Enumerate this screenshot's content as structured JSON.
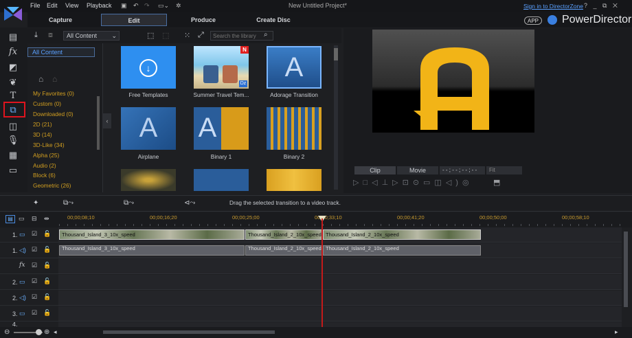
{
  "menu": [
    "File",
    "Edit",
    "View",
    "Playback"
  ],
  "project_title": "New Untitled Project*",
  "signin": "Sign in to DirectorZone",
  "window_controls": "? _ ⧉ ✕",
  "brand": {
    "app_badge": "APP",
    "name": "PowerDirector",
    "accent": "#3a7fe0"
  },
  "modes": {
    "capture": "Capture",
    "edit": "Edit",
    "produce": "Produce",
    "create_disc": "Create Disc"
  },
  "library": {
    "filter": "All Content",
    "search_placeholder": "Search the library"
  },
  "categories": {
    "all": "All Content",
    "items": [
      "My Favorites  (0)",
      "Custom  (0)",
      "Downloaded  (0)",
      "2D  (21)",
      "3D  (14)",
      "3D-Like  (34)",
      "Alpha  (25)",
      "Audio  (2)",
      "Block  (6)",
      "Geometric  (26)"
    ]
  },
  "thumbnails": [
    {
      "label": "Free Templates",
      "badge": ""
    },
    {
      "label": "Summer Travel Tem...",
      "badge": "N"
    },
    {
      "label": "Adorage Transition",
      "badge": ""
    },
    {
      "label": "Airplane",
      "badge": ""
    },
    {
      "label": "Binary 1",
      "badge": ""
    },
    {
      "label": "Binary 2",
      "badge": ""
    }
  ],
  "thumb_glyph": "A",
  "preview": {
    "clip_tab": "Clip",
    "movie_tab": "Movie",
    "timecode": "- - ; - - ; - - ; - -",
    "fit": "Fit",
    "letter": "A"
  },
  "fx_hint": "Drag the selected transition to a video track.",
  "ruler": [
    "00;00;08;10",
    "00;00;16;20",
    "00;00;25;00",
    "00;00;33;10",
    "00;00;41;20",
    "00;00;50;00",
    "00;00;58;10"
  ],
  "tracks": {
    "t1_video_label": "1.",
    "t1_audio_label": "1.",
    "fx_label": "fx",
    "t2_video_label": "2.",
    "t2_audio_label": "2.",
    "t3_video_label": "3.",
    "t4_label": "4."
  },
  "clips": {
    "v1": "Thousand_Island_3_10x_speed",
    "v2": "Thousand_Island_2_10x_speed",
    "v3": "Thousand_Island_2_10x_speed",
    "a1": "Thousand_Island_3_10x_speed",
    "a2": "Thousand_Island_2_10x_speed",
    "a3": "Thousand_Island_2_10x_speed"
  },
  "colors": {
    "category_text": "#d29f20",
    "selected_outline": "#e0141e",
    "link": "#5aa0ff",
    "playhead": "#c41a1a"
  }
}
